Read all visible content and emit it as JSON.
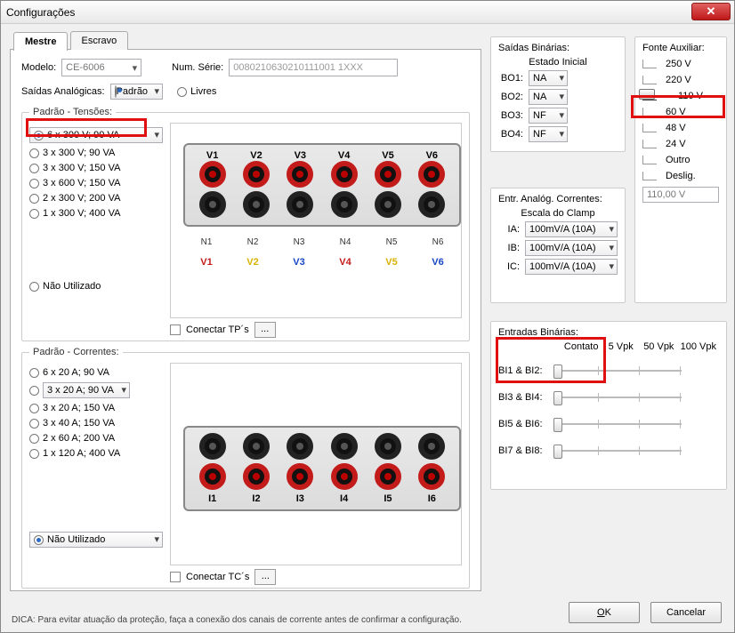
{
  "window": {
    "title": "Configurações"
  },
  "tabs": {
    "mestre": "Mestre",
    "escravo": "Escravo"
  },
  "model": {
    "label": "Modelo:",
    "value": "CE-6006",
    "serial_label": "Num. Série:",
    "serial_value": "0080210630210111001 1XXX"
  },
  "analog_out": {
    "label": "Saídas Analógicas:",
    "mode_padrao": "Padrão",
    "mode_livres": "Livres"
  },
  "tensoes": {
    "legend": "Padrão - Tensões:",
    "opts": [
      "6 x 300 V; 90 VA",
      "3 x 300 V; 90 VA",
      "3 x 300 V; 150 VA",
      "3 x 600 V; 150 VA",
      "2 x 300 V; 200 VA",
      "1 x 300 V; 400 VA"
    ],
    "nao_utilizado": "Não Utilizado",
    "conectar_tp": "Conectar TP´s",
    "v_labels": [
      "V1",
      "V2",
      "V3",
      "V4",
      "V5",
      "V6"
    ],
    "n_labels": [
      "N1",
      "N2",
      "N3",
      "N4",
      "N5",
      "N6"
    ]
  },
  "correntes": {
    "legend": "Padrão - Correntes:",
    "opts": [
      "6 x 20 A; 90 VA",
      "3 x 20 A; 90 VA",
      "3 x 20 A; 150 VA",
      "3 x 40 A; 150 VA",
      "2 x 60 A; 200 VA",
      "1 x 120 A; 400 VA"
    ],
    "nao_utilizado": "Não Utilizado",
    "conectar_tc": "Conectar TC´s",
    "i_labels": [
      "I1",
      "I2",
      "I3",
      "I4",
      "I5",
      "I6"
    ]
  },
  "saidas_bin": {
    "legend": "Saídas Binárias:",
    "estado": "Estado Inicial",
    "rows": [
      {
        "lbl": "BO1:",
        "val": "NA"
      },
      {
        "lbl": "BO2:",
        "val": "NA"
      },
      {
        "lbl": "BO3:",
        "val": "NF"
      },
      {
        "lbl": "BO4:",
        "val": "NF"
      }
    ]
  },
  "entr_analog": {
    "legend": "Entr. Analóg. Correntes:",
    "escala": "Escala do Clamp",
    "rows": [
      {
        "lbl": "IA:",
        "val": "100mV/A (10A)"
      },
      {
        "lbl": "IB:",
        "val": "100mV/A (10A)"
      },
      {
        "lbl": "IC:",
        "val": "100mV/A (10A)"
      }
    ]
  },
  "entradas_bin": {
    "legend": "Entradas Binárias:",
    "cols": [
      "Contato",
      "5 Vpk",
      "50 Vpk",
      "100 Vpk"
    ],
    "rows": [
      "BI1 & BI2:",
      "BI3 & BI4:",
      "BI5 & BI6:",
      "BI7 & BI8:"
    ]
  },
  "fonte_aux": {
    "legend": "Fonte Auxiliar:",
    "opts": [
      "250 V",
      "220 V",
      "110 V",
      "60 V",
      "48 V",
      "24 V",
      "Outro",
      "Deslig."
    ],
    "value": "110,00 V"
  },
  "hint": "DICA: Para evitar atuação da proteção, faça a conexão dos canais de corrente antes de confirmar a configuração.",
  "buttons": {
    "ok": "OK",
    "cancel": "Cancelar"
  }
}
